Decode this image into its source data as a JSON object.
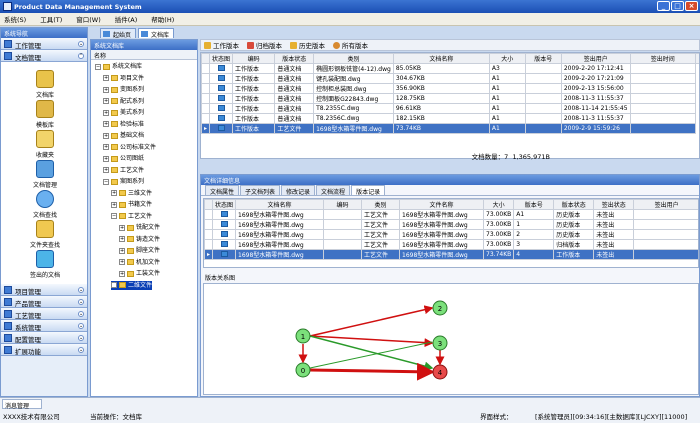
{
  "app": {
    "title": "Product Data Management System"
  },
  "menu": [
    "系统(S)",
    "工具(T)",
    "窗口(W)",
    "插件(A)",
    "帮助(H)"
  ],
  "dock_tabs": [
    "起始页",
    "文档库"
  ],
  "nav": {
    "header": "系统导航",
    "top_groups": [
      "工作管理",
      "文档管理"
    ],
    "items": [
      "文档库",
      "模板库",
      "收藏夹",
      "文档管理",
      "文档查找",
      "文件夹查找",
      "签出的文档"
    ],
    "bottom_groups": [
      "项目管理",
      "产品管理",
      "工艺管理",
      "系统管理",
      "配置管理",
      "扩展功能"
    ]
  },
  "tree": {
    "header": "系统文档库",
    "column": "名称",
    "nodes": [
      "系统文档库",
      "项目文件",
      "变图系列",
      "配式系列",
      "美式系列",
      "检验标准",
      "基础文档",
      "公司标准文件",
      "公司图纸",
      "工艺文件",
      "案图系列",
      "三维文件",
      "书籍文件",
      "工艺文件",
      "铣配文件",
      "铸造文件",
      "脚座文件",
      "机加文件",
      "工装文件",
      "二维文件"
    ]
  },
  "toolbar": [
    "工作版本",
    "归档版本",
    "历史版本",
    "所有版本"
  ],
  "grid1": {
    "headers": [
      "状态图",
      "编码",
      "版本状态",
      "类别",
      "文档名称",
      "大小",
      "版本号",
      "签出用户",
      "签出时间"
    ],
    "rows": [
      [
        "",
        "工作版本",
        "普通文档",
        "椭圆形钢板铣管(4-12).dwg",
        "85.05KB",
        "A3",
        "",
        "2009-2-20 17:12:41"
      ],
      [
        "",
        "工作版本",
        "普通文档",
        "键孔装配图.dwg",
        "304.67KB",
        "A1",
        "",
        "2009-2-20 17:21:09"
      ],
      [
        "",
        "工作版本",
        "普通文档",
        "控制柜总装图.dwg",
        "356.90KB",
        "A1",
        "",
        "2009-2-13 15:56:00"
      ],
      [
        "",
        "工作版本",
        "普通文档",
        "控制面板G22843.dwg",
        "128.75KB",
        "A1",
        "",
        "2008-11-3 11:55:37"
      ],
      [
        "",
        "工作版本",
        "普通文档",
        "T8.2355C.dwg",
        "96.61KB",
        "A1",
        "",
        "2008-11-14 21:55:45"
      ],
      [
        "",
        "工作版本",
        "普通文档",
        "T8.2356C.dwg",
        "182.15KB",
        "A1",
        "",
        "2008-11-3 11:55:37"
      ],
      [
        "",
        "工作版本",
        "工艺文件",
        "1698型水箱零件图.dwg",
        "73.74KB",
        "A1",
        "",
        "2009-2-9 15:59:26"
      ]
    ],
    "status": "文档数量：7",
    "total": "1,365,971B"
  },
  "detail": {
    "header": "文档详细信息",
    "tabs": [
      "文档属性",
      "子文档列表",
      "修改记录",
      "文档流程",
      "版本记录"
    ],
    "headers": [
      "状态图",
      "文档名称",
      "编码",
      "类别",
      "文件名称",
      "大小",
      "版本号",
      "版本状态",
      "签出状态",
      "签出用户"
    ],
    "rows": [
      [
        "1698型水箱零件图.dwg",
        "",
        "工艺文件",
        "1698型水箱零件图.dwg",
        "73.00KB",
        "A1",
        "历史版本",
        "未签出",
        ""
      ],
      [
        "1698型水箱零件图.dwg",
        "",
        "工艺文件",
        "1698型水箱零件图.dwg",
        "73.00KB",
        "1",
        "历史版本",
        "未签出",
        ""
      ],
      [
        "1698型水箱零件图.dwg",
        "",
        "工艺文件",
        "1698型水箱零件图.dwg",
        "73.00KB",
        "2",
        "历史版本",
        "未签出",
        ""
      ],
      [
        "1698型水箱零件图.dwg",
        "",
        "工艺文件",
        "1698型水箱零件图.dwg",
        "73.00KB",
        "3",
        "归档版本",
        "未签出",
        ""
      ],
      [
        "1698型水箱零件图.dwg",
        "",
        "工艺文件",
        "1698型水箱零件图.dwg",
        "73.74KB",
        "4",
        "工作版本",
        "未签出",
        ""
      ]
    ],
    "graph_label": "版本关系图",
    "graph_nodes": [
      "1",
      "2",
      "3",
      "4",
      "0"
    ]
  },
  "status": {
    "tab": "消息管理",
    "company": "XXXX技术有限公司",
    "operation": "当前操作：文档库",
    "style": "界面样式：",
    "right": "[系统管理员][09:34:16][主数据库][LJCXY][11000]"
  },
  "colors": {
    "title": "#1b4fb4",
    "selection": "#3f72c4",
    "node_green": "#7be07b",
    "node_red": "#e84a4a",
    "edge_red": "#d01010",
    "edge_green": "#2a9a2a"
  }
}
